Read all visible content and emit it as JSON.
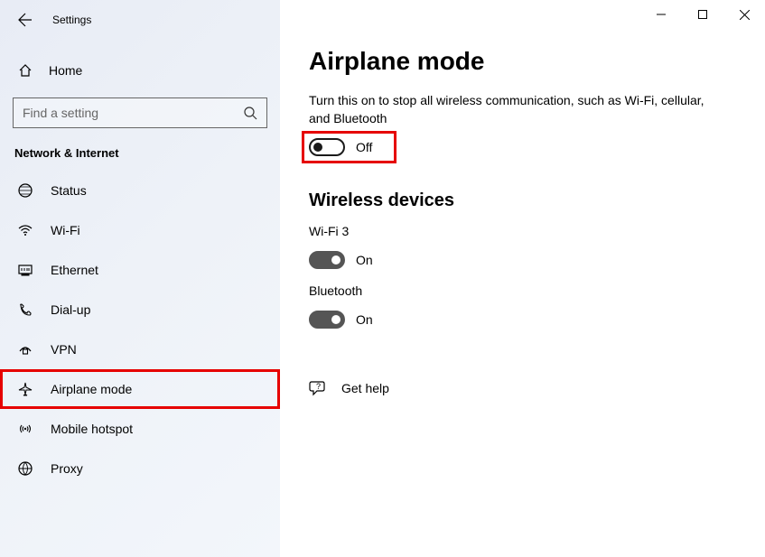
{
  "titlebar": {
    "app_title": "Settings"
  },
  "home": {
    "label": "Home"
  },
  "search": {
    "placeholder": "Find a setting"
  },
  "section_label": "Network & Internet",
  "nav": {
    "items": [
      {
        "label": "Status"
      },
      {
        "label": "Wi-Fi"
      },
      {
        "label": "Ethernet"
      },
      {
        "label": "Dial-up"
      },
      {
        "label": "VPN"
      },
      {
        "label": "Airplane mode"
      },
      {
        "label": "Mobile hotspot"
      },
      {
        "label": "Proxy"
      }
    ]
  },
  "main": {
    "heading": "Airplane mode",
    "description": "Turn this on to stop all wireless communication, such as Wi-Fi, cellular, and Bluetooth",
    "airplane_toggle_label": "Off",
    "wireless_heading": "Wireless devices",
    "wifi_label": "Wi-Fi 3",
    "wifi_toggle_label": "On",
    "bt_label": "Bluetooth",
    "bt_toggle_label": "On",
    "help_label": "Get help"
  }
}
